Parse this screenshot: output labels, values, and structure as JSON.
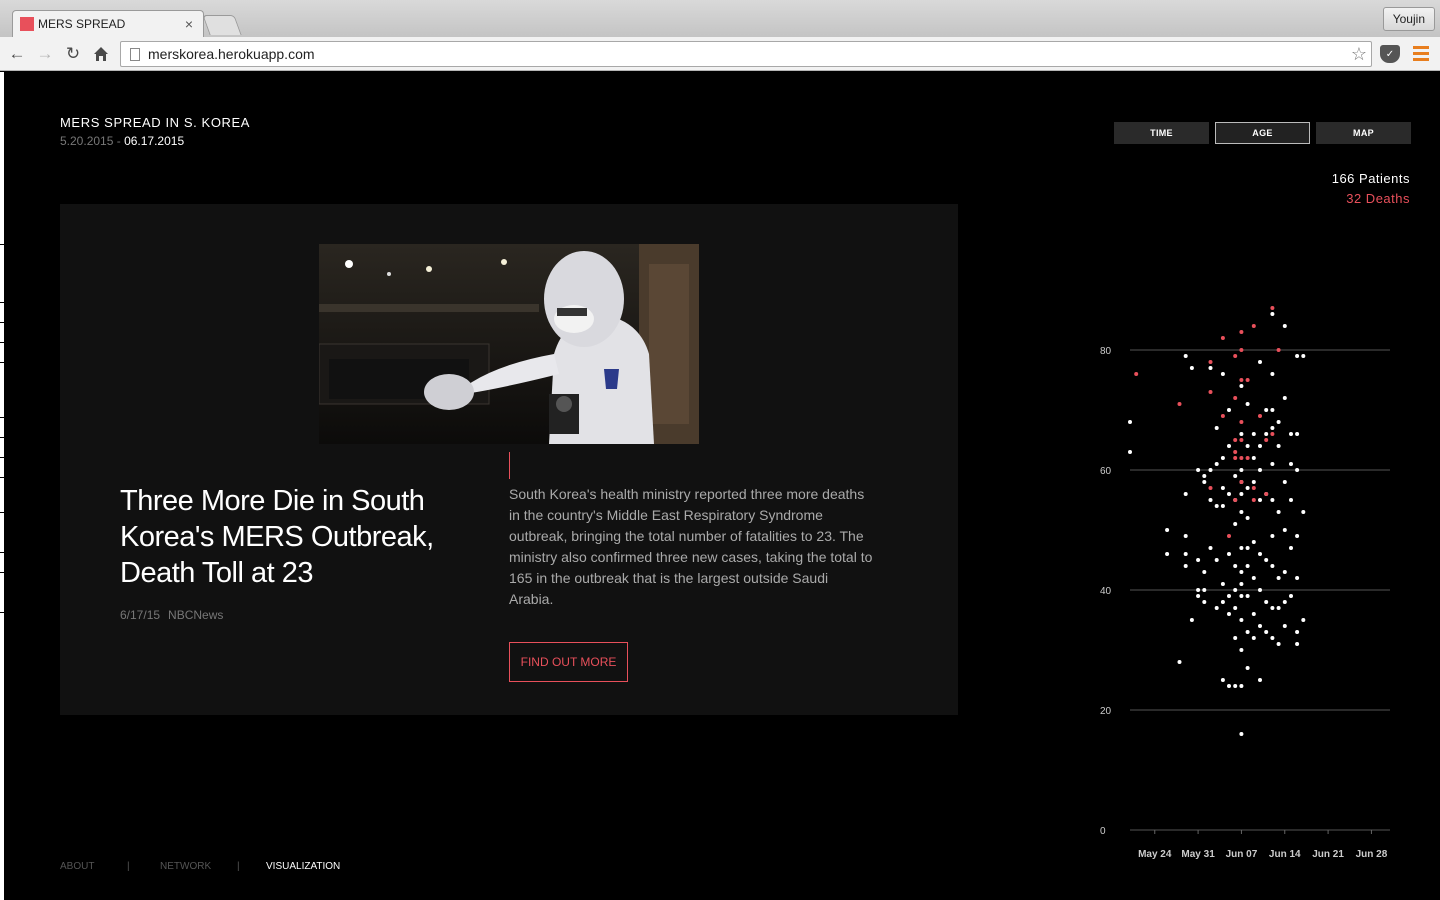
{
  "browser": {
    "tab_title": "MERS SPREAD",
    "tab_close": "×",
    "profile_name": "Youjin",
    "url": "merskorea.herokuapp.com",
    "accent_color": "#e8505b"
  },
  "header": {
    "title": "MERS SPREAD IN S. KOREA",
    "date_start": "5.20.2015 - ",
    "date_end": "06.17.2015"
  },
  "views": {
    "time": "TIME",
    "age": "AGE",
    "map": "MAP",
    "active": "AGE"
  },
  "stats": {
    "patients": "166 Patients",
    "deaths": "32 Deaths"
  },
  "article": {
    "headline": "Three More Die in South Korea's MERS Outbreak, Death Toll at 23",
    "date": "6/17/15",
    "source": "NBCNews",
    "summary": "South Korea's health ministry reported three more deaths in the country's Middle East Respiratory Syndrome outbreak, bringing the total number of fatalities to 23. The ministry also confirmed three new cases, taking the total to 165 in the outbreak that is the largest outside Saudi Arabia.",
    "button": "FIND OUT MORE"
  },
  "footer": {
    "about": "ABOUT",
    "network": "NETWORK",
    "visualization": "VISUALIZATION",
    "separator": "|"
  },
  "chart_data": {
    "type": "scatter",
    "ylim": [
      0,
      90
    ],
    "y_ticks": [
      "0",
      "20",
      "40",
      "60",
      "80"
    ],
    "x_start": "2015-05-20",
    "x_end": "2015-07-01",
    "x_ticks": [
      "May 24",
      "May 31",
      "Jun 07",
      "Jun 14",
      "Jun 21",
      "Jun 28"
    ],
    "series": [
      {
        "status": "alive",
        "color": "#ffffff",
        "points": [
          [
            "2015-05-20",
            68
          ],
          [
            "2015-05-20",
            63
          ],
          [
            "2015-05-26",
            50
          ],
          [
            "2015-05-26",
            46
          ],
          [
            "2015-05-28",
            28
          ],
          [
            "2015-05-29",
            79
          ],
          [
            "2015-05-29",
            56
          ],
          [
            "2015-05-29",
            49
          ],
          [
            "2015-05-29",
            46
          ],
          [
            "2015-05-29",
            44
          ],
          [
            "2015-05-30",
            35
          ],
          [
            "2015-05-30",
            77
          ],
          [
            "2015-05-31",
            45
          ],
          [
            "2015-05-31",
            40
          ],
          [
            "2015-05-31",
            39
          ],
          [
            "2015-05-31",
            60
          ],
          [
            "2015-06-01",
            59
          ],
          [
            "2015-06-01",
            58
          ],
          [
            "2015-06-01",
            40
          ],
          [
            "2015-06-01",
            38
          ],
          [
            "2015-06-01",
            43
          ],
          [
            "2015-06-02",
            60
          ],
          [
            "2015-06-02",
            55
          ],
          [
            "2015-06-02",
            77
          ],
          [
            "2015-06-02",
            47
          ],
          [
            "2015-06-03",
            61
          ],
          [
            "2015-06-03",
            67
          ],
          [
            "2015-06-03",
            54
          ],
          [
            "2015-06-03",
            45
          ],
          [
            "2015-06-03",
            37
          ],
          [
            "2015-06-04",
            76
          ],
          [
            "2015-06-04",
            62
          ],
          [
            "2015-06-04",
            57
          ],
          [
            "2015-06-04",
            54
          ],
          [
            "2015-06-04",
            41
          ],
          [
            "2015-06-04",
            38
          ],
          [
            "2015-06-04",
            25
          ],
          [
            "2015-06-05",
            70
          ],
          [
            "2015-06-05",
            64
          ],
          [
            "2015-06-05",
            56
          ],
          [
            "2015-06-05",
            46
          ],
          [
            "2015-06-05",
            39
          ],
          [
            "2015-06-05",
            36
          ],
          [
            "2015-06-05",
            24
          ],
          [
            "2015-06-06",
            59
          ],
          [
            "2015-06-06",
            55
          ],
          [
            "2015-06-06",
            51
          ],
          [
            "2015-06-06",
            44
          ],
          [
            "2015-06-06",
            40
          ],
          [
            "2015-06-06",
            37
          ],
          [
            "2015-06-06",
            32
          ],
          [
            "2015-06-06",
            24
          ],
          [
            "2015-06-07",
            74
          ],
          [
            "2015-06-07",
            66
          ],
          [
            "2015-06-07",
            60
          ],
          [
            "2015-06-07",
            58
          ],
          [
            "2015-06-07",
            56
          ],
          [
            "2015-06-07",
            53
          ],
          [
            "2015-06-07",
            47
          ],
          [
            "2015-06-07",
            43
          ],
          [
            "2015-06-07",
            41
          ],
          [
            "2015-06-07",
            39
          ],
          [
            "2015-06-07",
            35
          ],
          [
            "2015-06-07",
            30
          ],
          [
            "2015-06-07",
            24
          ],
          [
            "2015-06-07",
            16
          ],
          [
            "2015-06-08",
            71
          ],
          [
            "2015-06-08",
            64
          ],
          [
            "2015-06-08",
            57
          ],
          [
            "2015-06-08",
            52
          ],
          [
            "2015-06-08",
            47
          ],
          [
            "2015-06-08",
            44
          ],
          [
            "2015-06-08",
            39
          ],
          [
            "2015-06-08",
            33
          ],
          [
            "2015-06-08",
            27
          ],
          [
            "2015-06-09",
            66
          ],
          [
            "2015-06-09",
            62
          ],
          [
            "2015-06-09",
            58
          ],
          [
            "2015-06-09",
            48
          ],
          [
            "2015-06-09",
            42
          ],
          [
            "2015-06-09",
            36
          ],
          [
            "2015-06-09",
            32
          ],
          [
            "2015-06-10",
            78
          ],
          [
            "2015-06-10",
            64
          ],
          [
            "2015-06-10",
            60
          ],
          [
            "2015-06-10",
            55
          ],
          [
            "2015-06-10",
            46
          ],
          [
            "2015-06-10",
            40
          ],
          [
            "2015-06-10",
            34
          ],
          [
            "2015-06-10",
            25
          ],
          [
            "2015-06-11",
            70
          ],
          [
            "2015-06-11",
            66
          ],
          [
            "2015-06-11",
            56
          ],
          [
            "2015-06-11",
            45
          ],
          [
            "2015-06-11",
            38
          ],
          [
            "2015-06-11",
            33
          ],
          [
            "2015-06-12",
            76
          ],
          [
            "2015-06-12",
            70
          ],
          [
            "2015-06-12",
            67
          ],
          [
            "2015-06-12",
            61
          ],
          [
            "2015-06-12",
            55
          ],
          [
            "2015-06-12",
            49
          ],
          [
            "2015-06-12",
            44
          ],
          [
            "2015-06-12",
            37
          ],
          [
            "2015-06-12",
            32
          ],
          [
            "2015-06-12",
            86
          ],
          [
            "2015-06-13",
            68
          ],
          [
            "2015-06-13",
            64
          ],
          [
            "2015-06-13",
            53
          ],
          [
            "2015-06-13",
            42
          ],
          [
            "2015-06-13",
            37
          ],
          [
            "2015-06-13",
            31
          ],
          [
            "2015-06-14",
            84
          ],
          [
            "2015-06-14",
            72
          ],
          [
            "2015-06-14",
            58
          ],
          [
            "2015-06-14",
            50
          ],
          [
            "2015-06-14",
            43
          ],
          [
            "2015-06-14",
            38
          ],
          [
            "2015-06-14",
            34
          ],
          [
            "2015-06-15",
            66
          ],
          [
            "2015-06-15",
            61
          ],
          [
            "2015-06-15",
            55
          ],
          [
            "2015-06-15",
            47
          ],
          [
            "2015-06-15",
            39
          ],
          [
            "2015-06-16",
            79
          ],
          [
            "2015-06-16",
            66
          ],
          [
            "2015-06-16",
            60
          ],
          [
            "2015-06-16",
            49
          ],
          [
            "2015-06-16",
            42
          ],
          [
            "2015-06-16",
            33
          ],
          [
            "2015-06-16",
            31
          ],
          [
            "2015-06-17",
            79
          ],
          [
            "2015-06-17",
            53
          ],
          [
            "2015-06-17",
            35
          ]
        ]
      },
      {
        "status": "deceased",
        "color": "#e8505b",
        "points": [
          [
            "2015-05-21",
            76
          ],
          [
            "2015-05-28",
            71
          ],
          [
            "2015-06-02",
            78
          ],
          [
            "2015-06-02",
            73
          ],
          [
            "2015-06-02",
            57
          ],
          [
            "2015-06-04",
            82
          ],
          [
            "2015-06-04",
            69
          ],
          [
            "2015-06-05",
            49
          ],
          [
            "2015-06-06",
            79
          ],
          [
            "2015-06-06",
            72
          ],
          [
            "2015-06-06",
            65
          ],
          [
            "2015-06-06",
            63
          ],
          [
            "2015-06-06",
            62
          ],
          [
            "2015-06-06",
            55
          ],
          [
            "2015-06-07",
            83
          ],
          [
            "2015-06-07",
            80
          ],
          [
            "2015-06-07",
            75
          ],
          [
            "2015-06-07",
            68
          ],
          [
            "2015-06-07",
            65
          ],
          [
            "2015-06-07",
            62
          ],
          [
            "2015-06-07",
            58
          ],
          [
            "2015-06-08",
            75
          ],
          [
            "2015-06-08",
            62
          ],
          [
            "2015-06-09",
            84
          ],
          [
            "2015-06-09",
            57
          ],
          [
            "2015-06-09",
            55
          ],
          [
            "2015-06-10",
            69
          ],
          [
            "2015-06-11",
            65
          ],
          [
            "2015-06-12",
            87
          ],
          [
            "2015-06-12",
            66
          ],
          [
            "2015-06-13",
            80
          ],
          [
            "2015-06-11",
            56
          ]
        ]
      }
    ]
  }
}
